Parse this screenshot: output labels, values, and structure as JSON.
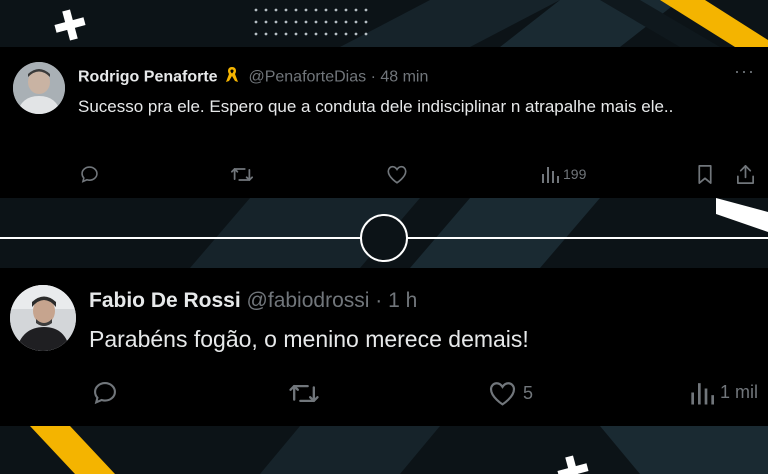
{
  "tweets": [
    {
      "name": "Rodrigo Penaforte",
      "handle": "@PenaforteDias",
      "separator": "·",
      "time": "48 min",
      "text": "Sucesso pra ele. Espero que a conduta dele indisciplinar n atrapalhe mais ele..",
      "more": "···",
      "views": "199"
    },
    {
      "name": "Fabio De Rossi",
      "handle": "@fabiodrossi",
      "separator": "·",
      "time": "1 h",
      "text": "Parabéns fogão, o menino merece demais!",
      "likes": "5",
      "views": "1 mil"
    }
  ],
  "colors": {
    "background": "#0c1317",
    "card": "#000000",
    "accent_yellow": "#f4b400",
    "name": "#e7e9ea",
    "muted": "#71767b"
  },
  "icons": [
    "reply-icon",
    "retweet-icon",
    "like-icon",
    "views-icon",
    "bookmark-icon",
    "share-icon",
    "ribbon-badge-icon"
  ]
}
